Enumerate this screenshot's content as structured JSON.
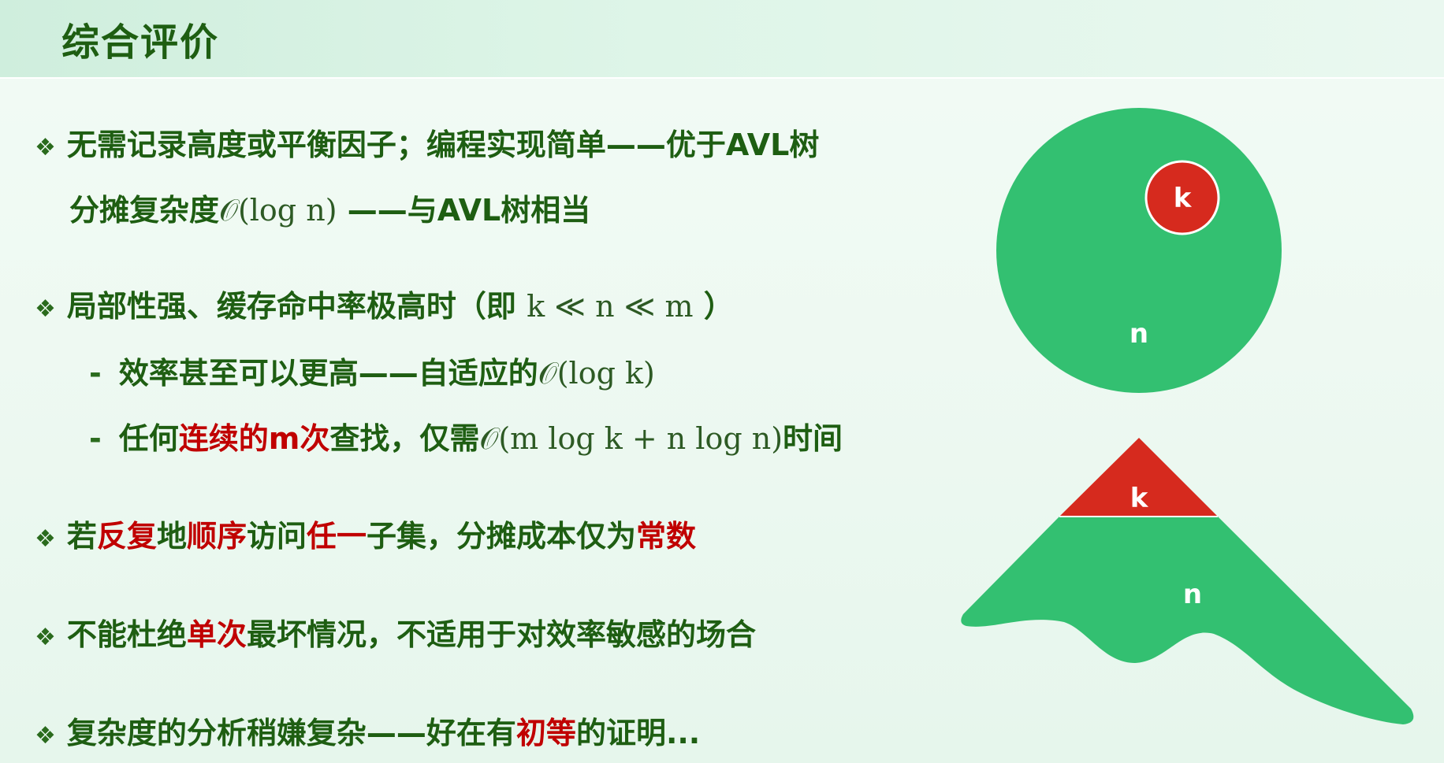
{
  "title": "综合评价",
  "bullets": {
    "b1": {
      "line1": "无需记录高度或平衡因子；编程实现简单——优于AVL树",
      "line2_pre": "分摊复杂度",
      "line2_math": "𝒪(log n)",
      "line2_post": " ——与AVL树相当"
    },
    "b2": {
      "pre": "局部性强、缓存命中率极高时（即 ",
      "math": "k ≪ n ≪ m",
      "post": " ）",
      "sub1_pre": "效率甚至可以更高——自适应的",
      "sub1_math": "𝒪(log k)",
      "sub2_a": "任何",
      "sub2_red": "连续的m次",
      "sub2_b": "查找，仅需",
      "sub2_math": "𝒪(m log k + n log n)",
      "sub2_c": "时间"
    },
    "b3": {
      "a": "若",
      "r1": "反复",
      "b": "地",
      "r2": "顺序",
      "c": "访问",
      "r3": "任一",
      "d": "子集，分摊成本仅为",
      "r4": "常数"
    },
    "b4": {
      "a": "不能杜绝",
      "r1": "单次",
      "b": "最坏情况，不适用于对效率敏感的场合"
    },
    "b5": {
      "a": "复杂度的分析稍嫌复杂——好在有",
      "r1": "初等",
      "b": "的证明..."
    },
    "bullet_symbol": "❖",
    "dash_symbol": "-"
  },
  "figure": {
    "circle_outer_label": "n",
    "circle_inner_label": "k",
    "tree_top_label": "k",
    "tree_bottom_label": "n"
  },
  "colors": {
    "green_fill": "#33c071",
    "red_fill": "#d62a1e",
    "text_dark_green": "#1e5e12",
    "emphasis_red": "#c00000"
  }
}
